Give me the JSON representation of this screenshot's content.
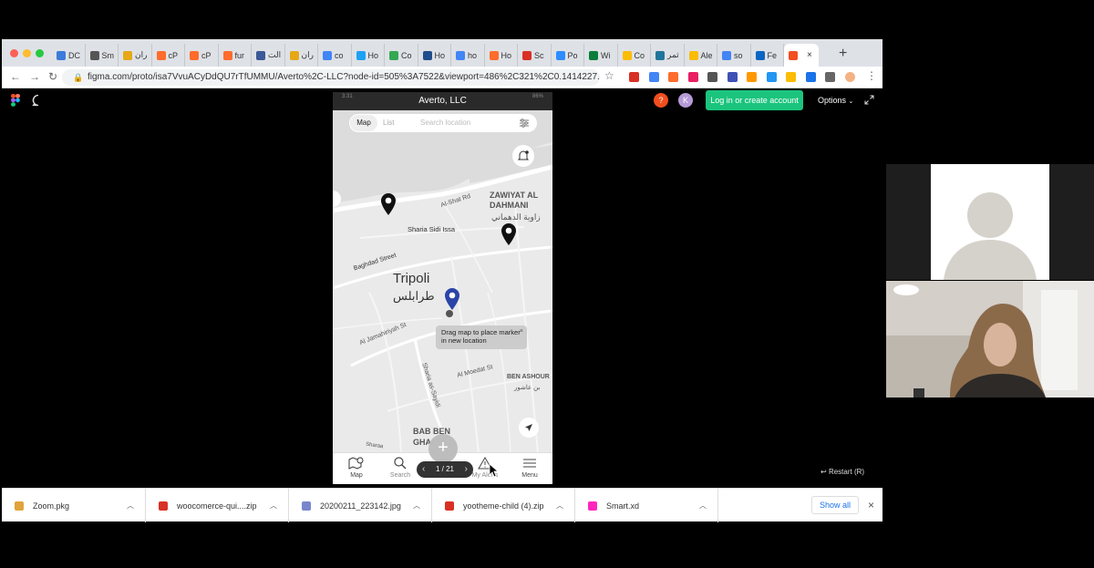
{
  "browser": {
    "tabs": [
      {
        "label": "DC",
        "color": "#3b7bd9"
      },
      {
        "label": "Sm",
        "color": "#555555"
      },
      {
        "label": "ران",
        "color": "#e6a817"
      },
      {
        "label": "cP",
        "color": "#ff6c2c"
      },
      {
        "label": "cP",
        "color": "#ff6c2c"
      },
      {
        "label": "fur",
        "color": "#ff6c2c"
      },
      {
        "label": "الت",
        "color": "#3b5998"
      },
      {
        "label": "ران",
        "color": "#e6a817"
      },
      {
        "label": "co",
        "color": "#4285f4"
      },
      {
        "label": "Ho",
        "color": "#1da1f2"
      },
      {
        "label": "Co",
        "color": "#34a853"
      },
      {
        "label": "Ho",
        "color": "#1f4e8c"
      },
      {
        "label": "ho",
        "color": "#4285f4"
      },
      {
        "label": "Ho",
        "color": "#ff6c2c"
      },
      {
        "label": "Sc",
        "color": "#d93025"
      },
      {
        "label": "Po",
        "color": "#2d8cff"
      },
      {
        "label": "Wi",
        "color": "#0a7d3c"
      },
      {
        "label": "Co",
        "color": "#fbbc04"
      },
      {
        "label": "ثمر",
        "color": "#21759b"
      },
      {
        "label": "Ale",
        "color": "#fbbc04"
      },
      {
        "label": "so",
        "color": "#4285f4"
      },
      {
        "label": "Fe",
        "color": "#0a66c2"
      },
      {
        "label": "",
        "color": "#f24e1e"
      }
    ],
    "new_tab": "+",
    "url": "figma.com/proto/isa7VvuACyDdQU7rTfUMMU/Averto%2C-LLC?node-id=505%3A7522&viewport=486%2C321%2C0.1414227...",
    "extension_colors": [
      "#d93025",
      "#4285f4",
      "#ff6c2c",
      "#e91e63",
      "#555555",
      "#3f51b5",
      "#ff9800",
      "#2196f3",
      "#fbbc04",
      "#1a73e8",
      "#666666",
      "#f4b183"
    ]
  },
  "figma": {
    "login_button": "Log in or create account",
    "options_label": "Options",
    "help_badge": "?",
    "avatar_initial": "K",
    "restart_label": "Restart (R)"
  },
  "phone": {
    "title": "Averto, LLC",
    "time": "3:31",
    "battery": "86%",
    "segment_map": "Map",
    "segment_list": "List",
    "search_placeholder": "Search location",
    "map_labels": {
      "zawiyat": "ZAWIYAT AL\nDAHMANI",
      "zawiyat_ar": "زاوية الدهماني",
      "al_shat": "Al-Shat Rd",
      "sidi_issa": "Sharia Sidi Issa",
      "baghdad": "Baghdad Street",
      "tripoli": "Tripoli",
      "tripoli_ar": "طرابلس",
      "jamahiriyah": "Al Jamahiriyah St",
      "sharia_sayidi": "Sharia as-Sayidi",
      "moedat": "Al Moedat St",
      "ben_ashour": "BEN ASHOUR",
      "ben_ashour_ar": "بن عاشور",
      "bab_ben": "BAB BEN\nGHA",
      "sharaa": "Sharaa"
    },
    "tooltip": "Drag map to place marker in new location",
    "tooltip_close": "×",
    "fab_label": "+",
    "pager": "1 / 21",
    "nav": {
      "map": "Map",
      "search": "Search",
      "alerts": "My Alerts",
      "menu": "Menu"
    }
  },
  "downloads": {
    "items": [
      {
        "name": "Zoom.pkg",
        "color": "#e0a43a"
      },
      {
        "name": "woocomerce-qui....zip",
        "color": "#d93025"
      },
      {
        "name": "20200211_223142.jpg",
        "color": "#7986cb"
      },
      {
        "name": "yootheme-child (4).zip",
        "color": "#d93025"
      },
      {
        "name": "Smart.xd",
        "color": "#ff26be"
      }
    ],
    "show_all": "Show all",
    "close": "×"
  },
  "colors": {
    "figma_green": "#1bc47d",
    "pin_active": "#2a45a8",
    "pin_default": "#111111"
  }
}
